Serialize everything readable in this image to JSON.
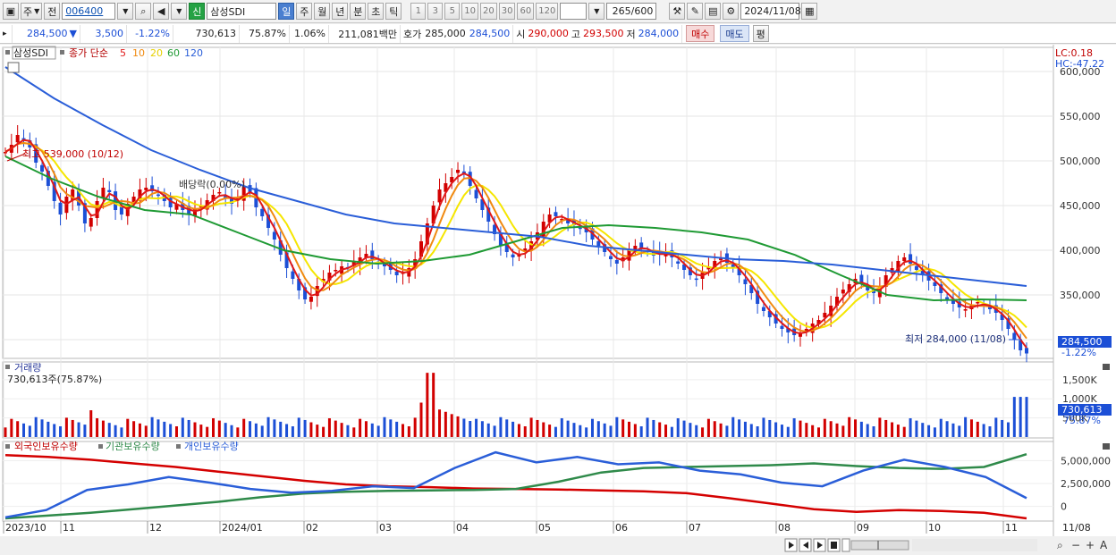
{
  "toolbar": {
    "market": "주",
    "prev": "전",
    "code": "006400",
    "stock_badge": "신",
    "stock_name": "삼성SDI",
    "periods": [
      "일",
      "주",
      "월",
      "년",
      "분",
      "초",
      "틱"
    ],
    "active_period": "일",
    "intervals": [
      "1",
      "3",
      "5",
      "10",
      "20",
      "30",
      "60",
      "120"
    ],
    "count": "265",
    "count_total": "/600",
    "date": "2024/11/08"
  },
  "quote": {
    "price": "284,500",
    "change_arrow": "▼",
    "change": "3,500",
    "change_pct": "-1.22%",
    "volume": "730,613",
    "vol_ratio": "75.87%",
    "turnover_pct": "1.06%",
    "amount": "211,081백만",
    "hoga_label": "호가",
    "ask": "285,000",
    "bid": "284,500",
    "open_label": "시",
    "open": "290,000",
    "high_label": "고",
    "high": "293,500",
    "low_label": "저",
    "low": "284,000",
    "buy_label": "매수",
    "sell_label": "매도",
    "avg_label": "평"
  },
  "price_panel": {
    "title": "삼성SDI",
    "ma_label": "종가 단순",
    "ma_periods": [
      "5",
      "10",
      "20",
      "60",
      "120"
    ],
    "lc": "LC:0.18",
    "hc": "HC:-47.22",
    "y_ticks": [
      "600,000",
      "550,000",
      "500,000",
      "450,000",
      "400,000",
      "350,000",
      "300,000"
    ],
    "high_annotation": "최고 539,000 (10/12)",
    "low_annotation": "최저 284,000 (11/08)",
    "dividend_annotation": "배당락(0.00%)",
    "last_price_tag": "284,500",
    "last_pct_tag": "-1.22%"
  },
  "volume_panel": {
    "title": "거래량",
    "value_label": "730,613주(75.87%)",
    "y_ticks": [
      "1,500K",
      "1,000K",
      "500K"
    ],
    "last_tag": "730,613",
    "last_pct": "75.87%"
  },
  "holdings_panel": {
    "legend": [
      "외국인보유수량",
      "기관보유수량",
      "개인보유수량"
    ],
    "y_ticks": [
      "5,000,000",
      "2,500,000",
      "0"
    ]
  },
  "x_axis": {
    "labels": [
      "2023/10",
      "11",
      "12",
      "2024/01",
      "02",
      "03",
      "04",
      "05",
      "06",
      "07",
      "08",
      "09",
      "10",
      "11"
    ],
    "last": "11/08"
  },
  "colors": {
    "ma5": "#e01818",
    "ma10": "#f08a10",
    "ma20": "#f5e600",
    "ma60": "#1f9a34",
    "ma120": "#2a5ed8",
    "up": "#d20000",
    "down": "#1c4fd6",
    "foreign": "#d40000",
    "inst": "#2f8a4a",
    "individual": "#2a5ed8"
  },
  "chart_data": {
    "type": "candlestick",
    "x_range": [
      "2023/10",
      "2024/11/08"
    ],
    "price_ylim": [
      280000,
      620000
    ],
    "close": [
      510000,
      518000,
      529000,
      523000,
      515000,
      498000,
      488000,
      472000,
      455000,
      440000,
      460000,
      468000,
      450000,
      430000,
      436000,
      455000,
      470000,
      465000,
      445000,
      440000,
      452000,
      460000,
      468000,
      470000,
      466000,
      462000,
      455000,
      448000,
      452000,
      445000,
      440000,
      446000,
      450000,
      456000,
      462000,
      465000,
      458000,
      452000,
      458000,
      472000,
      465000,
      448000,
      438000,
      425000,
      412000,
      395000,
      380000,
      368000,
      355000,
      345000,
      348000,
      360000,
      368000,
      375000,
      378000,
      382000,
      380000,
      388000,
      392000,
      396000,
      390000,
      385000,
      382000,
      378000,
      372000,
      375000,
      380000,
      390000,
      410000,
      430000,
      450000,
      468000,
      475000,
      482000,
      490000,
      486000,
      472000,
      458000,
      445000,
      432000,
      418000,
      405000,
      398000,
      392000,
      395000,
      402000,
      410000,
      420000,
      432000,
      440000,
      438000,
      435000,
      430000,
      428000,
      425000,
      420000,
      412000,
      405000,
      398000,
      390000,
      385000,
      392000,
      400000,
      405000,
      402000,
      398000,
      394000,
      395000,
      398000,
      392000,
      385000,
      378000,
      372000,
      368000,
      375000,
      382000,
      388000,
      392000,
      386000,
      380000,
      372000,
      362000,
      352000,
      340000,
      332000,
      325000,
      318000,
      312000,
      308000,
      305000,
      308000,
      312000,
      318000,
      322000,
      330000,
      338000,
      348000,
      356000,
      362000,
      368000,
      362000,
      355000,
      352000,
      360000,
      372000,
      380000,
      388000,
      392000,
      385000,
      378000,
      372000,
      366000,
      360000,
      352000,
      345000,
      340000,
      336000,
      334000,
      338000,
      342000,
      338000,
      334000,
      330000,
      322000,
      312000,
      300000,
      288000,
      284500
    ],
    "ma60": [
      505000,
      480000,
      460000,
      445000,
      440000,
      420000,
      400000,
      390000,
      385000,
      388000,
      395000,
      410000,
      425000,
      428000,
      425000,
      420000,
      412000,
      395000,
      372000,
      350000,
      344000,
      345000,
      344000
    ],
    "ma120": [
      605000,
      570000,
      540000,
      512000,
      490000,
      470000,
      455000,
      440000,
      430000,
      425000,
      420000,
      415000,
      405000,
      400000,
      395000,
      390000,
      388000,
      384000,
      378000,
      372000,
      366000,
      360000
    ],
    "volume_ylim": [
      0,
      1800000
    ],
    "holdings_ylim": [
      -1500000,
      6500000
    ],
    "foreign": [
      5600000,
      5400000,
      5100000,
      4700000,
      4300000,
      3800000,
      3300000,
      2800000,
      2400000,
      2200000,
      2100000,
      1950000,
      1900000,
      1850000,
      1750000,
      1650000,
      1450000,
      900000,
      300000,
      -300000,
      -600000,
      -400000,
      -500000,
      -700000,
      -1300000
    ],
    "institution": [
      -1300000,
      -1000000,
      -700000,
      -300000,
      100000,
      500000,
      1000000,
      1400000,
      1600000,
      1700000,
      1750000,
      1800000,
      1900000,
      2700000,
      3700000,
      4200000,
      4300000,
      4400000,
      4500000,
      4700000,
      4400000,
      4200000,
      4100000,
      4300000,
      5700000
    ],
    "individual": [
      -1200000,
      -400000,
      1800000,
      2400000,
      3200000,
      2600000,
      1900000,
      1500000,
      1700000,
      2200000,
      2000000,
      4200000,
      5900000,
      4800000,
      5400000,
      4600000,
      4800000,
      3900000,
      3500000,
      2600000,
      2200000,
      3900000,
      5100000,
      4300000,
      3200000,
      900000
    ]
  }
}
